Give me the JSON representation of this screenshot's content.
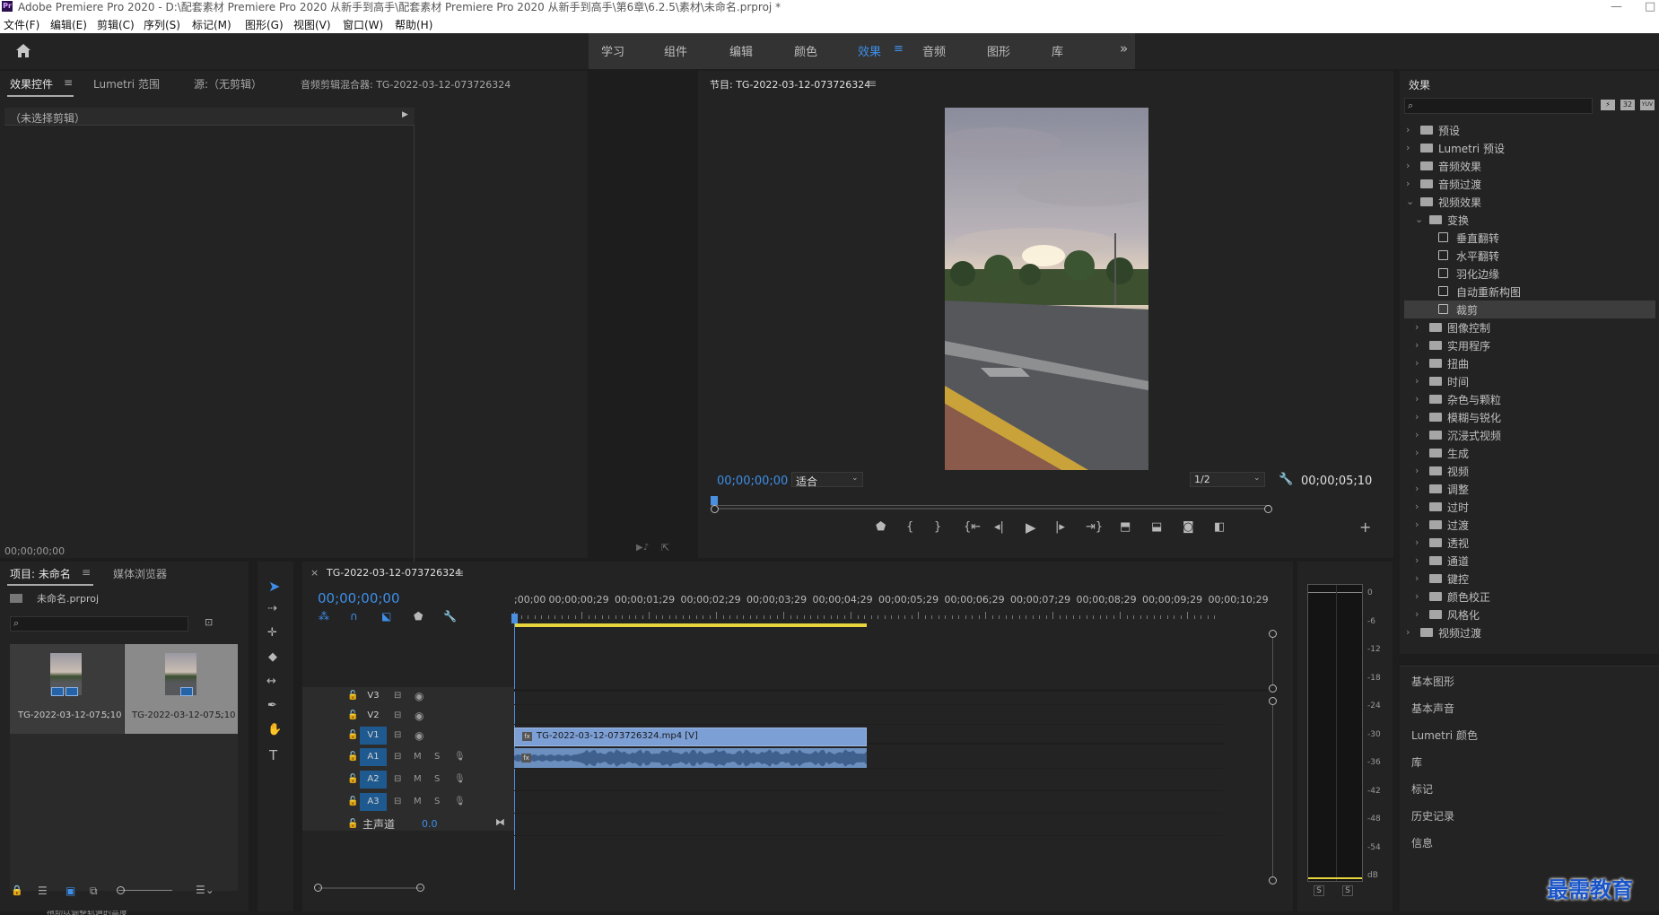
{
  "window": {
    "title": "Adobe Premiere Pro 2020 - D:\\配套素材 Premiere Pro 2020 从新手到高手\\配套素材 Premiere Pro 2020 从新手到高手\\第6章\\6.2.5\\素材\\未命名.prproj *",
    "logo_text": "Pr",
    "minimize": "—",
    "restore": "□"
  },
  "menu": [
    "文件(F)",
    "编辑(E)",
    "剪辑(C)",
    "序列(S)",
    "标记(M)",
    "图形(G)",
    "视图(V)",
    "窗口(W)",
    "帮助(H)"
  ],
  "workspaces": {
    "items": [
      "学习",
      "组件",
      "编辑",
      "颜色",
      "效果",
      "音频",
      "图形",
      "库"
    ],
    "active": "效果",
    "menu_icon": "≡",
    "more": "»"
  },
  "effect_controls": {
    "tabs": [
      "效果控件",
      "Lumetri 范围",
      "源:（无剪辑）",
      "音频剪辑混合器: TG-2022-03-12-073726324"
    ],
    "no_clip": "（未选择剪辑）",
    "timecode": "00;00;00;00"
  },
  "program": {
    "title": "节目: TG-2022-03-12-073726324",
    "timecode": "00;00;00;00",
    "fit": "适合",
    "resolution": "1/2",
    "duration": "00;00;05;10",
    "playhead_progress": 0.0
  },
  "effects_panel": {
    "title": "效果",
    "search_placeholder": "",
    "filter_icons": [
      "32",
      "YUV"
    ],
    "tree": [
      {
        "label": "预设",
        "level": 0,
        "type": "special-folder",
        "open": false
      },
      {
        "label": "Lumetri 预设",
        "level": 0,
        "type": "special-folder",
        "open": false
      },
      {
        "label": "音频效果",
        "level": 0,
        "type": "folder",
        "open": false
      },
      {
        "label": "音频过渡",
        "level": 0,
        "type": "folder",
        "open": false
      },
      {
        "label": "视频效果",
        "level": 0,
        "type": "folder",
        "open": true
      },
      {
        "label": "变换",
        "level": 1,
        "type": "folder",
        "open": true
      },
      {
        "label": "垂直翻转",
        "level": 2,
        "type": "effect"
      },
      {
        "label": "水平翻转",
        "level": 2,
        "type": "effect"
      },
      {
        "label": "羽化边缘",
        "level": 2,
        "type": "effect"
      },
      {
        "label": "自动重新构图",
        "level": 2,
        "type": "effect"
      },
      {
        "label": "裁剪",
        "level": 2,
        "type": "effect",
        "selected": true
      },
      {
        "label": "图像控制",
        "level": 1,
        "type": "folder",
        "open": false
      },
      {
        "label": "实用程序",
        "level": 1,
        "type": "folder",
        "open": false
      },
      {
        "label": "扭曲",
        "level": 1,
        "type": "folder",
        "open": false
      },
      {
        "label": "时间",
        "level": 1,
        "type": "folder",
        "open": false
      },
      {
        "label": "杂色与颗粒",
        "level": 1,
        "type": "folder",
        "open": false
      },
      {
        "label": "模糊与锐化",
        "level": 1,
        "type": "folder",
        "open": false
      },
      {
        "label": "沉浸式视频",
        "level": 1,
        "type": "folder",
        "open": false
      },
      {
        "label": "生成",
        "level": 1,
        "type": "folder",
        "open": false
      },
      {
        "label": "视频",
        "level": 1,
        "type": "folder",
        "open": false
      },
      {
        "label": "调整",
        "level": 1,
        "type": "folder",
        "open": false
      },
      {
        "label": "过时",
        "level": 1,
        "type": "folder",
        "open": false
      },
      {
        "label": "过渡",
        "level": 1,
        "type": "folder",
        "open": false
      },
      {
        "label": "透视",
        "level": 1,
        "type": "folder",
        "open": false
      },
      {
        "label": "通道",
        "level": 1,
        "type": "folder",
        "open": false
      },
      {
        "label": "键控",
        "level": 1,
        "type": "folder",
        "open": false
      },
      {
        "label": "颜色校正",
        "level": 1,
        "type": "folder",
        "open": false
      },
      {
        "label": "风格化",
        "level": 1,
        "type": "folder",
        "open": false
      },
      {
        "label": "视频过渡",
        "level": 0,
        "type": "folder",
        "open": false
      }
    ],
    "collapsed_panels": [
      "基本图形",
      "基本声音",
      "Lumetri 颜色",
      "库",
      "标记",
      "历史记录",
      "信息"
    ]
  },
  "project": {
    "tabs": [
      "项目: 未命名",
      "媒体浏览器"
    ],
    "file": "未命名.prproj",
    "items": [
      {
        "name": "TG-2022-03-12-07...",
        "duration": "5;10"
      },
      {
        "name": "TG-2022-03-12-07...",
        "duration": "5;10"
      }
    ]
  },
  "timeline": {
    "close": "×",
    "sequence": "TG-2022-03-12-073726324",
    "timecode": "00;00;00;00",
    "ruler": [
      ";00;00",
      "00;00;00;29",
      "00;00;01;29",
      "00;00;02;29",
      "00;00;03;29",
      "00;00;04;29",
      "00;00;05;29",
      "00;00;06;29",
      "00;00;07;29",
      "00;00;08;29",
      "00;00;09;29",
      "00;00;10;29"
    ],
    "video_tracks": [
      "V3",
      "V2",
      "V1"
    ],
    "audio_tracks": [
      "A1",
      "A2",
      "A3"
    ],
    "master": "主声道",
    "master_value": "0.0",
    "mute": "M",
    "solo": "S",
    "fx_badge": "fx",
    "clip_video": "TG-2022-03-12-073726324.mp4 [V]"
  },
  "meter": {
    "scale": [
      "0",
      "-6",
      "-12",
      "-18",
      "-24",
      "-30",
      "-36",
      "-42",
      "-48",
      "-54",
      "dB"
    ],
    "solo_labels": [
      "S",
      "S"
    ]
  },
  "status_bar": "拖动以调整轨道的高度",
  "watermark": "最需教育",
  "colors": {
    "accent": "#3e8ee8",
    "panel_bg": "#232323",
    "clip_video": "#7c9fd6",
    "clip_audio": "#6b8fbf",
    "track_target": "#1e5a8f",
    "playhead": "#4a8fe0",
    "work_area": "#e8d43c"
  }
}
